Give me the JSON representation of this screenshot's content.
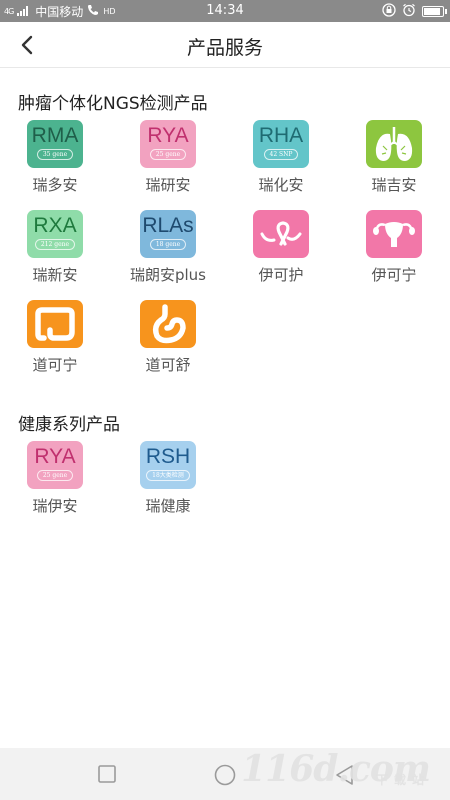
{
  "status_bar": {
    "signal": "4G",
    "carrier": "中国移动",
    "hd_badge": "HD",
    "time": "14:34"
  },
  "header": {
    "title": "产品服务",
    "back_icon": "chevron-left-icon"
  },
  "sections": [
    {
      "title": "肿瘤个体化NGS检测产品",
      "products": [
        {
          "code": "RMA",
          "sub": "35 gene",
          "label": "瑞多安",
          "bg": "#4cb38f",
          "fg": "#1f5f4a"
        },
        {
          "code": "RYA",
          "sub": "25 gene",
          "label": "瑞研安",
          "bg": "#f2a2c0",
          "fg": "#c0306e"
        },
        {
          "code": "RHA",
          "sub": "42 SNP",
          "label": "瑞化安",
          "bg": "#63c5c9",
          "fg": "#1f6b72"
        },
        {
          "code": "",
          "sub": "",
          "label": "瑞吉安",
          "bg": "#8dc63f",
          "fg": "#ffffff",
          "icon": "lungs-icon"
        },
        {
          "code": "RXA",
          "sub": "212 gene",
          "label": "瑞新安",
          "bg": "#8fdca9",
          "fg": "#1f7a3e"
        },
        {
          "code": "RLAs",
          "sub": "18 gene",
          "label": "瑞朗安plus",
          "bg": "#7fb8dc",
          "fg": "#1f4a6e"
        },
        {
          "code": "",
          "sub": "",
          "label": "伊可护",
          "bg": "#f277a8",
          "fg": "#ffffff",
          "icon": "ribbon-icon"
        },
        {
          "code": "",
          "sub": "",
          "label": "伊可宁",
          "bg": "#f277a8",
          "fg": "#ffffff",
          "icon": "uterus-icon"
        },
        {
          "code": "",
          "sub": "",
          "label": "道可宁",
          "bg": "#f7941d",
          "fg": "#ffffff",
          "icon": "colon-icon"
        },
        {
          "code": "",
          "sub": "",
          "label": "道可舒",
          "bg": "#f7941d",
          "fg": "#ffffff",
          "icon": "stomach-icon"
        }
      ]
    },
    {
      "title": "健康系列产品",
      "products": [
        {
          "code": "RYA",
          "sub": "25 gene",
          "label": "瑞伊安",
          "bg": "#f2a2c0",
          "fg": "#c0306e"
        },
        {
          "code": "RSH",
          "sub": "18大类检测",
          "label": "瑞健康",
          "bg": "#a6d0ee",
          "fg": "#1f5b8e"
        }
      ]
    }
  ],
  "nav_bar": {
    "recent_icon": "square-icon",
    "home_icon": "circle-icon",
    "back_icon": "triangle-back-icon"
  },
  "watermark": {
    "main": "116d.com",
    "small": "下载站"
  }
}
